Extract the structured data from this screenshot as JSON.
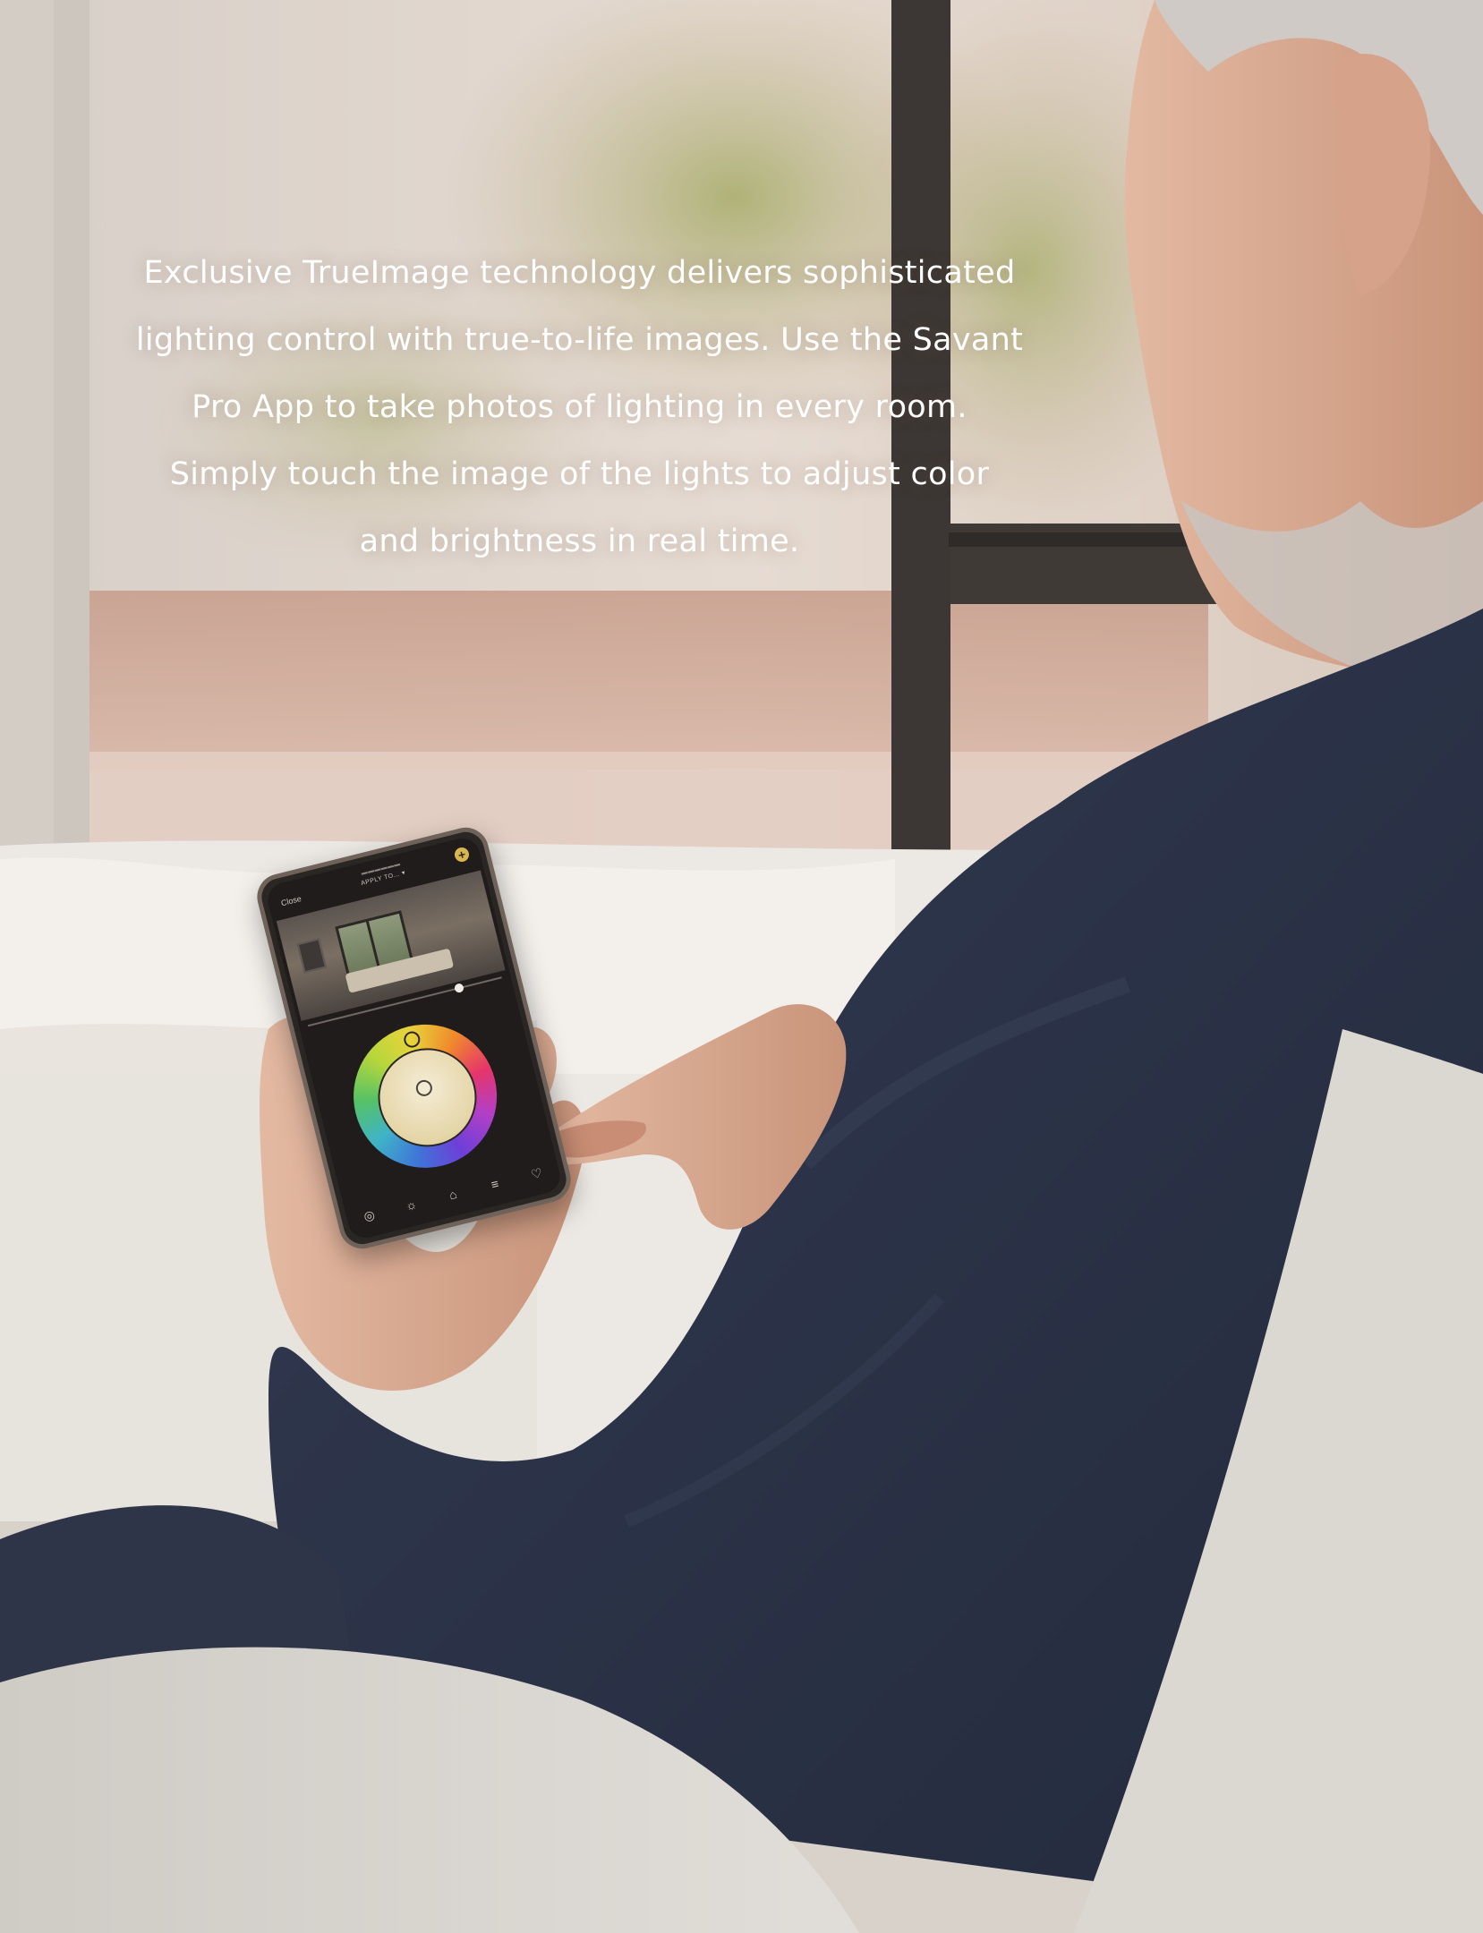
{
  "caption": {
    "line1": "Exclusive TrueImage technology delivers sophisticated",
    "line2": "lighting control with true-to-life images. Use the Savant",
    "line3": "Pro App to take photos of lighting in every room.",
    "line4": "Simply touch the image of the lights to adjust color",
    "line5": "and brightness in real time.",
    "color": "#ffffff"
  },
  "phone_app": {
    "close_label": "Close",
    "apply_label": "APPLY TO... ▾",
    "add_symbol": "+",
    "brightness_level": 0.78,
    "accent_color": "#d9b650",
    "tabs": [
      {
        "icon": "lens-icon",
        "glyph": "◎"
      },
      {
        "icon": "sun-icon",
        "glyph": "☼"
      },
      {
        "icon": "lamp-icon",
        "glyph": "⌂"
      },
      {
        "icon": "sliders-icon",
        "glyph": "≡"
      },
      {
        "icon": "heart-icon",
        "glyph": "♡"
      }
    ]
  },
  "colors": {
    "sweater": "#2c3347",
    "window_frame": "#3c3734",
    "bed": "#ece8e3",
    "chair": "#d4d0ca"
  }
}
